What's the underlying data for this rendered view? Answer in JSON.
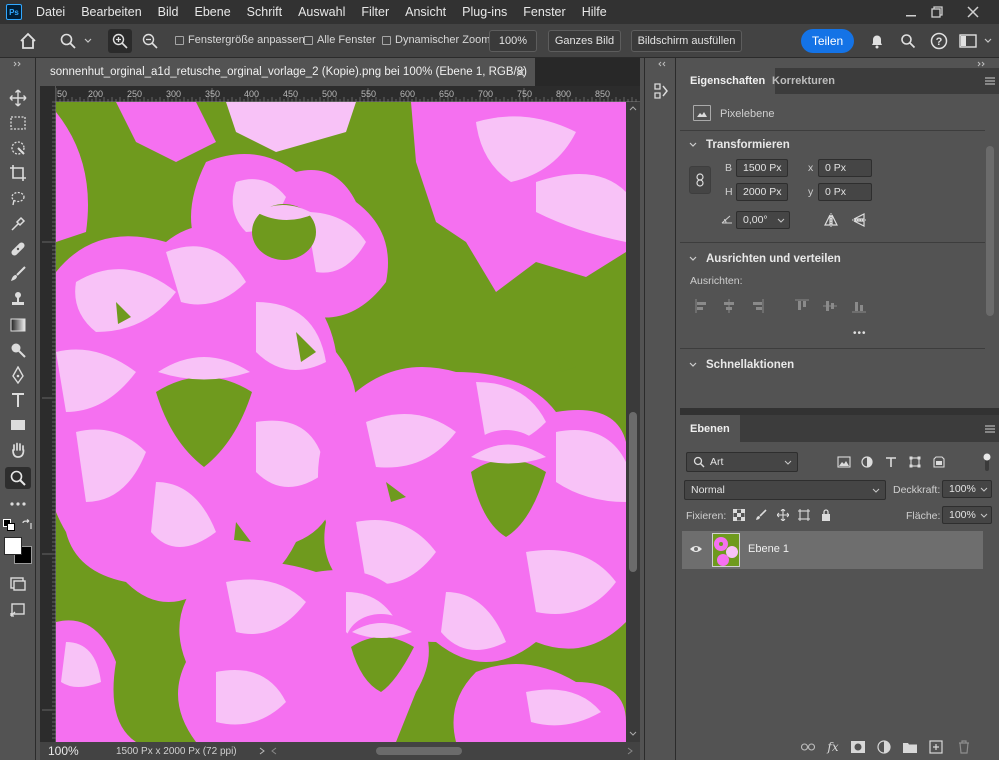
{
  "menubar": {
    "items": [
      "Datei",
      "Bearbeiten",
      "Bild",
      "Ebene",
      "Schrift",
      "Auswahl",
      "Filter",
      "Ansicht",
      "Plug-ins",
      "Fenster",
      "Hilfe"
    ],
    "logo_text": "Ps"
  },
  "options": {
    "resize_windows_label": "Fenstergröße anpassen",
    "all_windows_label": "Alle Fenster",
    "scrubby_zoom_label": "Dynamischer Zoom",
    "zoom_value": "100%",
    "fit_screen_label": "Ganzes Bild",
    "fill_screen_label": "Bildschirm ausfüllen",
    "share_label": "Teilen"
  },
  "document": {
    "tab_title": "sonnenhut_orginal_a1d_retusche_orginal_vorlage_2  (Kopie).png bei 100% (Ebene 1, RGB/8)",
    "ruler_top_ticks": [
      "50",
      "200",
      "250",
      "300",
      "350",
      "400",
      "450",
      "500",
      "550",
      "600",
      "650",
      "700",
      "750",
      "800",
      "850"
    ],
    "status_zoom": "100%",
    "status_info": "1500 Px x 2000 Px (72 ppi)",
    "colors": {
      "green": "#6f9a1e",
      "pink": "#f570f0",
      "light_pink": "#f8c2f7"
    }
  },
  "properties": {
    "tab_properties": "Eigenschaften",
    "tab_adjustments": "Korrekturen",
    "layer_type": "Pixelebene",
    "transform_title": "Transformieren",
    "w_label": "B",
    "w_value": "1500 Px",
    "h_label": "H",
    "h_value": "2000 Px",
    "x_label": "x",
    "x_value": "0 Px",
    "y_label": "y",
    "y_value": "0 Px",
    "angle_value": "0,00°",
    "align_title": "Ausrichten und verteilen",
    "align_sub": "Ausrichten:",
    "more": "•••",
    "quick_actions_title": "Schnellaktionen"
  },
  "layers": {
    "tab_label": "Ebenen",
    "filter_label": "Art",
    "blend_mode": "Normal",
    "opacity_label": "Deckkraft:",
    "opacity_value": "100%",
    "lock_label": "Fixieren:",
    "fill_label": "Fläche:",
    "fill_value": "100%",
    "layer_name": "Ebene 1"
  }
}
